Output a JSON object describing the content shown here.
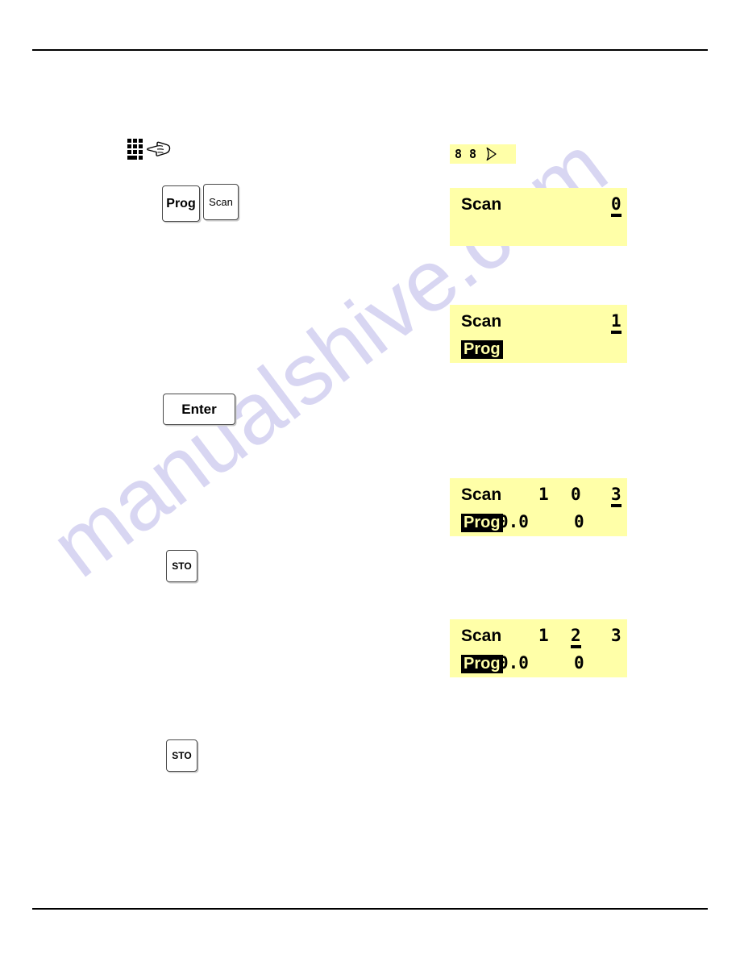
{
  "page": {
    "watermark": "manualshive.com",
    "rule_color": "#000000",
    "lcd_color": "#ffffa8"
  },
  "icons": {
    "keypad": "keypad-icon",
    "hand": "pointing-hand-icon",
    "arrow": "play-arrow-icon"
  },
  "keys": {
    "prog": "Prog",
    "scan": "Scan",
    "enter": "Enter",
    "sto_first": "STO",
    "sto_second": "STO"
  },
  "mini_display": {
    "digit_1": "8",
    "digit_2": "8",
    "arrow": "arrow-right-glyph"
  },
  "displays": [
    {
      "id": "scan-step-0",
      "line1_label": "Scan",
      "line1_a": "",
      "line1_b": "",
      "line1_c": "0",
      "line1_c_underlined": true,
      "line2_label": "",
      "line2_a": "",
      "line2_b": "",
      "line2_inverted": false
    },
    {
      "id": "scan-prog-step-1",
      "line1_label": "Scan",
      "line1_a": "",
      "line1_b": "",
      "line1_c": "1",
      "line1_c_underlined": true,
      "line2_label": "Prog",
      "line2_a": "",
      "line2_b": "",
      "line2_inverted": true
    },
    {
      "id": "scan-prog-step-103",
      "line1_label": "Scan",
      "line1_a": "1",
      "line1_b": "0",
      "line1_c": "3",
      "line1_c_underlined": true,
      "line2_label": "Prog",
      "line2_a": "0.0",
      "line2_b": "0",
      "line2_inverted": true
    },
    {
      "id": "scan-prog-step-123",
      "line1_label": "Scan",
      "line1_a": "1",
      "line1_b": "2",
      "line1_c": "3",
      "line1_b_underlined": true,
      "line1_c_underlined": false,
      "line2_label": "Prog",
      "line2_a": "0.0",
      "line2_b": "0",
      "line2_inverted": true
    }
  ]
}
